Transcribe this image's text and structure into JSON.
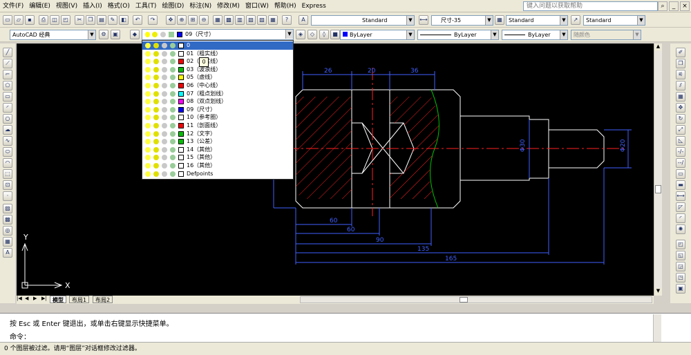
{
  "menu": [
    "文件(F)",
    "编辑(E)",
    "视图(V)",
    "插入(I)",
    "格式(O)",
    "工具(T)",
    "绘图(D)",
    "标注(N)",
    "修改(M)",
    "窗口(W)",
    "帮助(H)",
    "Express"
  ],
  "help_search": {
    "placeholder": "键入问题以获取帮助"
  },
  "styles": {
    "text_style": "Standard",
    "dim_style": "尺寸-35",
    "table_style": "Standard",
    "multileader_style": "Standard"
  },
  "workspace": "AutoCAD 经典",
  "current_layer": "09（尺寸）",
  "properties": {
    "color": "ByLayer",
    "linetype": "ByLayer",
    "lineweight": "ByLayer",
    "plotstyle": "随颜色"
  },
  "layers": [
    {
      "name": "0",
      "color": "#ffffff",
      "selected": true
    },
    {
      "name": "01（粗实线）",
      "color": "#ffffff"
    },
    {
      "name": "02（细实线）",
      "color": "#ff0000"
    },
    {
      "name": "03（波浪线）",
      "color": "#00c000"
    },
    {
      "name": "05（虚线）",
      "color": "#ffff00"
    },
    {
      "name": "06（中心线）",
      "color": "#ff0000"
    },
    {
      "name": "07（粗点划线）",
      "color": "#00ffff"
    },
    {
      "name": "08（双点划线）",
      "color": "#ff00ff"
    },
    {
      "name": "09（尺寸）",
      "color": "#0000ff"
    },
    {
      "name": "10（参考圈）",
      "color": "#ffffff"
    },
    {
      "name": "11（剖面线）",
      "color": "#ff0000"
    },
    {
      "name": "12（文字）",
      "color": "#00c000"
    },
    {
      "name": "13（公差）",
      "color": "#00c000"
    },
    {
      "name": "14（其他）",
      "color": "#ffffff"
    },
    {
      "name": "15（其他）",
      "color": "#ffffff"
    },
    {
      "name": "16（其他）",
      "color": "#ffffff"
    },
    {
      "name": "Defpoints",
      "color": "#ffffff"
    }
  ],
  "tooltip_text": "0",
  "drawing_dims": {
    "d1": "26",
    "d2": "20",
    "d3": "36",
    "h1": "60",
    "h2": "60",
    "h3": "90",
    "h4": "135",
    "h5": "165",
    "v1": "Φ30",
    "v2": "Φ20"
  },
  "ucs": {
    "x": "X",
    "y": "Y"
  },
  "tabs": [
    "模型",
    "布局1",
    "布局2"
  ],
  "command_history": "按 Esc 或 Enter 键退出，或单击右键显示快捷菜单。",
  "command_prompt": "命令：",
  "status_text": "0 个图层被过滤。请用“图层”对话框修改过滤器。"
}
